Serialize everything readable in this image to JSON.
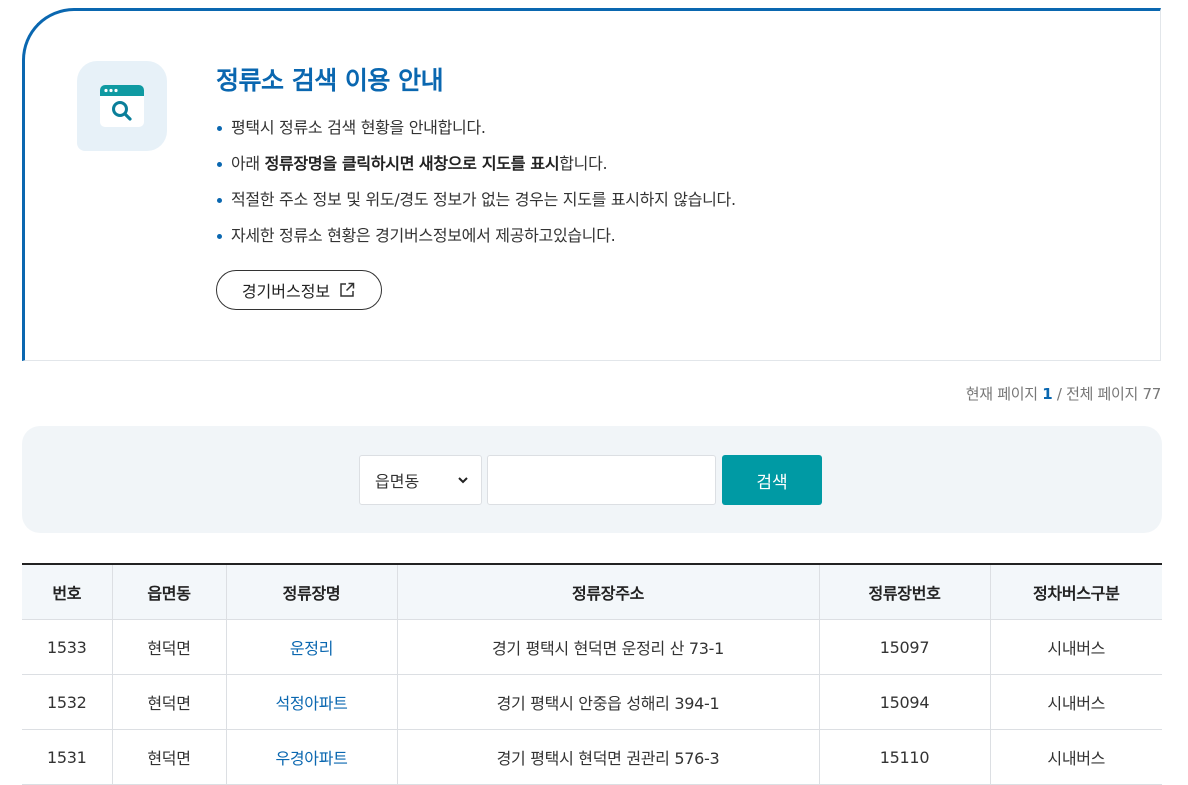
{
  "info": {
    "title": "정류소 검색 이용 안내",
    "items": [
      {
        "pre": "평택시 정류소 검색 현황을 안내합니다.",
        "bold1": "",
        "mid": "",
        "bold2": "",
        "post": ""
      },
      {
        "pre": "아래 ",
        "bold1": "정류장명을 클릭하시면",
        "mid": " ",
        "bold2": "새창으로 지도를 표시",
        "post": "합니다."
      },
      {
        "pre": "적절한 주소 정보 및 위도/경도 정보가 없는 경우는 지도를 표시하지 않습니다.",
        "bold1": "",
        "mid": "",
        "bold2": "",
        "post": ""
      },
      {
        "pre": "자세한 정류소 현황은 경기버스정보에서 제공하고있습니다.",
        "bold1": "",
        "mid": "",
        "bold2": "",
        "post": ""
      }
    ],
    "ext_button_label": "경기버스정보",
    "icon": "search-window-icon",
    "ext_icon": "external-link-icon"
  },
  "pagination": {
    "current_label": "현재 페이지",
    "current": "1",
    "separator": "/",
    "total_label": "전체 페이지",
    "total": "77"
  },
  "search": {
    "select_value": "읍면동",
    "keyword_value": "",
    "button_label": "검색"
  },
  "table": {
    "headers": [
      "번호",
      "읍면동",
      "정류장명",
      "정류장주소",
      "정류장번호",
      "정차버스구분"
    ],
    "rows": [
      {
        "no": "1533",
        "district": "현덕면",
        "name": "운정리",
        "address": "경기 평택시 현덕면 운정리 산 73-1",
        "stop_no": "15097",
        "type": "시내버스"
      },
      {
        "no": "1532",
        "district": "현덕면",
        "name": "석정아파트",
        "address": "경기 평택시 안중읍 성해리 394-1",
        "stop_no": "15094",
        "type": "시내버스"
      },
      {
        "no": "1531",
        "district": "현덕면",
        "name": "우경아파트",
        "address": "경기 평택시 현덕면 권관리 576-3",
        "stop_no": "15110",
        "type": "시내버스"
      }
    ]
  },
  "colors": {
    "primary_blue": "#0a67b0",
    "teal_button": "#009aa4",
    "panel_bg": "#f1f5f8"
  }
}
